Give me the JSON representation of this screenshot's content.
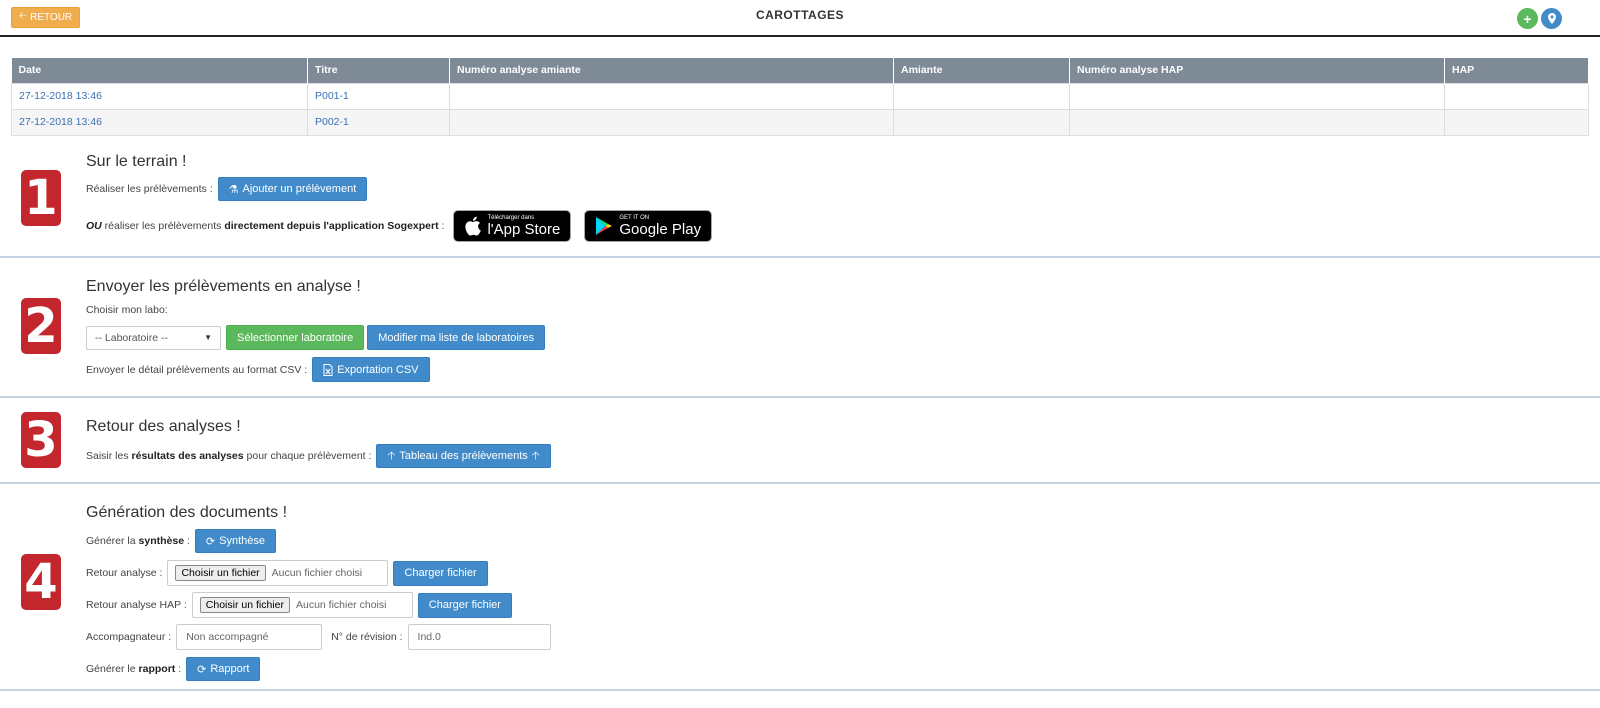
{
  "header": {
    "back_label": "RETOUR",
    "title": "CAROTTAGES"
  },
  "table": {
    "columns": [
      "Date",
      "Titre",
      "Numéro analyse amiante",
      "Amiante",
      "Numéro analyse HAP",
      "HAP"
    ],
    "rows": [
      [
        "27-12-2018 13:46",
        "P001-1",
        "",
        "",
        "",
        ""
      ],
      [
        "27-12-2018 13:46",
        "P002-1",
        "",
        "",
        "",
        ""
      ]
    ]
  },
  "step1": {
    "number": "1",
    "title": "Sur le terrain !",
    "line1_label": "Réaliser les prélèvements :",
    "add_button": "Ajouter un prélèvement",
    "line2_ou": "OU",
    "line2_mid": " réaliser les prélèvements ",
    "line2_bold": "directement depuis l'application Sogexpert",
    "line2_end": " :",
    "appstore_small": "Télécharger dans",
    "appstore_big": "l'App Store",
    "googleplay_small": "GET IT ON",
    "googleplay_big": "Google Play"
  },
  "step2": {
    "number": "2",
    "title": "Envoyer les prélèvements en analyse !",
    "choose_label": "Choisir mon labo:",
    "select_value": "-- Laboratoire --",
    "select_button": "Sélectionner laboratoire",
    "modify_button": "Modifier ma liste de laboratoires",
    "csv_label": "Envoyer le détail prélèvements au format CSV :",
    "csv_button": "Exportation CSV"
  },
  "step3": {
    "number": "3",
    "title": "Retour des analyses !",
    "line_start": "Saisir les ",
    "line_bold": "résultats des analyses",
    "line_end": " pour chaque prélèvement :",
    "table_button": "Tableau des prélèvements"
  },
  "step4": {
    "number": "4",
    "title": "Génération des documents !",
    "synth_label_start": "Générer la ",
    "synth_label_bold": "synthèse",
    "synth_label_end": " :",
    "synth_button": "Synthèse",
    "retour_label": "Retour analyse :",
    "retour_hap_label": "Retour analyse HAP :",
    "file_button": "Choisir un fichier",
    "no_file": "Aucun fichier choisi",
    "upload_button": "Charger fichier",
    "accomp_label": "Accompagnateur :",
    "accomp_placeholder": "Non accompagné",
    "revision_label": "N° de révision :",
    "revision_value": "Ind.0",
    "rapport_label_start": "Générer le ",
    "rapport_label_bold": "rapport",
    "rapport_label_end": " :",
    "rapport_button": "Rapport"
  },
  "colors": {
    "accent_blue": "#428bca",
    "success_green": "#5cb85c",
    "warning_orange": "#f0ad4e",
    "step_red": "#c4262e"
  }
}
